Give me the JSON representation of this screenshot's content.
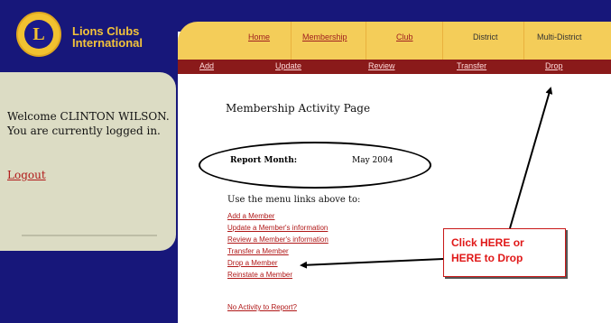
{
  "brand": {
    "line1": "Lions Clubs",
    "line2": "International",
    "logo_letter": "L"
  },
  "sidebar": {
    "welcome": "Welcome CLINTON WILSON. You are currently logged in.",
    "logout": "Logout"
  },
  "main_nav": [
    "Home",
    "Membership",
    "Club",
    "District",
    "Multi-District"
  ],
  "sub_nav": [
    "Add",
    "Update",
    "Review",
    "Transfer",
    "Drop"
  ],
  "content": {
    "title": "Membership Activity Page",
    "report_month_label": "Report Month:",
    "report_month_value": "May 2004",
    "instruction": "Use the menu links above to:",
    "links": [
      "Add a Member",
      "Update a Member's information",
      "Review a Member's information",
      "Transfer a Member",
      "Drop a Member",
      "Reinstate a Member"
    ],
    "no_activity": "No Activity to Report?"
  },
  "callout": {
    "line1": "Click HERE or",
    "line2": "HERE to Drop"
  },
  "colors": {
    "navy": "#17177a",
    "gold": "#f4cd59",
    "maroon": "#8a1a1a",
    "callout_red": "#e01818"
  }
}
